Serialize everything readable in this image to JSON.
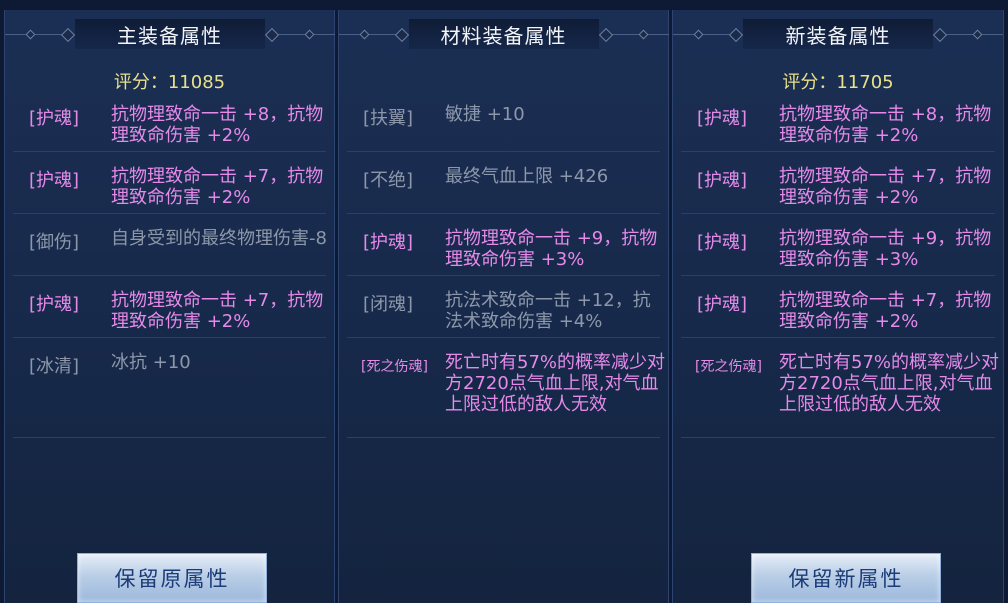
{
  "panels": [
    {
      "title": "主装备属性",
      "score": "评分：11085",
      "rows": [
        {
          "tag": "[护魂]",
          "text": "抗物理致命一击 +8，抗物理致命伤害 +2%",
          "color": "pink"
        },
        {
          "tag": "[护魂]",
          "text": "抗物理致命一击 +7，抗物理致命伤害 +2%",
          "color": "pink"
        },
        {
          "tag": "[御伤]",
          "text": "自身受到的最终物理伤害-8",
          "color": "grey"
        },
        {
          "tag": "[护魂]",
          "text": "抗物理致命一击 +7，抗物理致命伤害 +2%",
          "color": "pink"
        },
        {
          "tag": "[冰清]",
          "text": "冰抗 +10",
          "color": "grey"
        }
      ],
      "button": "保留原属性"
    },
    {
      "title": "材料装备属性",
      "rows": [
        {
          "tag": "[扶翼]",
          "text": "敏捷 +10",
          "color": "grey"
        },
        {
          "tag": "[不绝]",
          "text": "最终气血上限 +426",
          "color": "grey"
        },
        {
          "tag": "[护魂]",
          "text": "抗物理致命一击 +9，抗物理致命伤害 +3%",
          "color": "pink"
        },
        {
          "tag": "[闭魂]",
          "text": "抗法术致命一击 +12，抗法术致命伤害 +4%",
          "color": "grey"
        },
        {
          "tag": "[死之伤魂]",
          "text": "死亡时有57%的概率减少对方2720点气血上限,对气血上限过低的敌人无效",
          "color": "pink"
        }
      ]
    },
    {
      "title": "新装备属性",
      "score": "评分：11705",
      "rows": [
        {
          "tag": "[护魂]",
          "text": "抗物理致命一击 +8，抗物理致命伤害 +2%",
          "color": "pink"
        },
        {
          "tag": "[护魂]",
          "text": "抗物理致命一击 +7，抗物理致命伤害 +2%",
          "color": "pink"
        },
        {
          "tag": "[护魂]",
          "text": "抗物理致命一击 +9，抗物理致命伤害 +3%",
          "color": "pink"
        },
        {
          "tag": "[护魂]",
          "text": "抗物理致命一击 +7，抗物理致命伤害 +2%",
          "color": "pink"
        },
        {
          "tag": "[死之伤魂]",
          "text": "死亡时有57%的概率减少对方2720点气血上限,对气血上限过低的敌人无效",
          "color": "pink"
        }
      ],
      "button": "保留新属性"
    }
  ],
  "colors": {
    "attribute_pink": "#e58ae9",
    "attribute_grey": "#8d97aa",
    "score_yellow": "#e8e08a",
    "button_text": "#1b3c78"
  }
}
